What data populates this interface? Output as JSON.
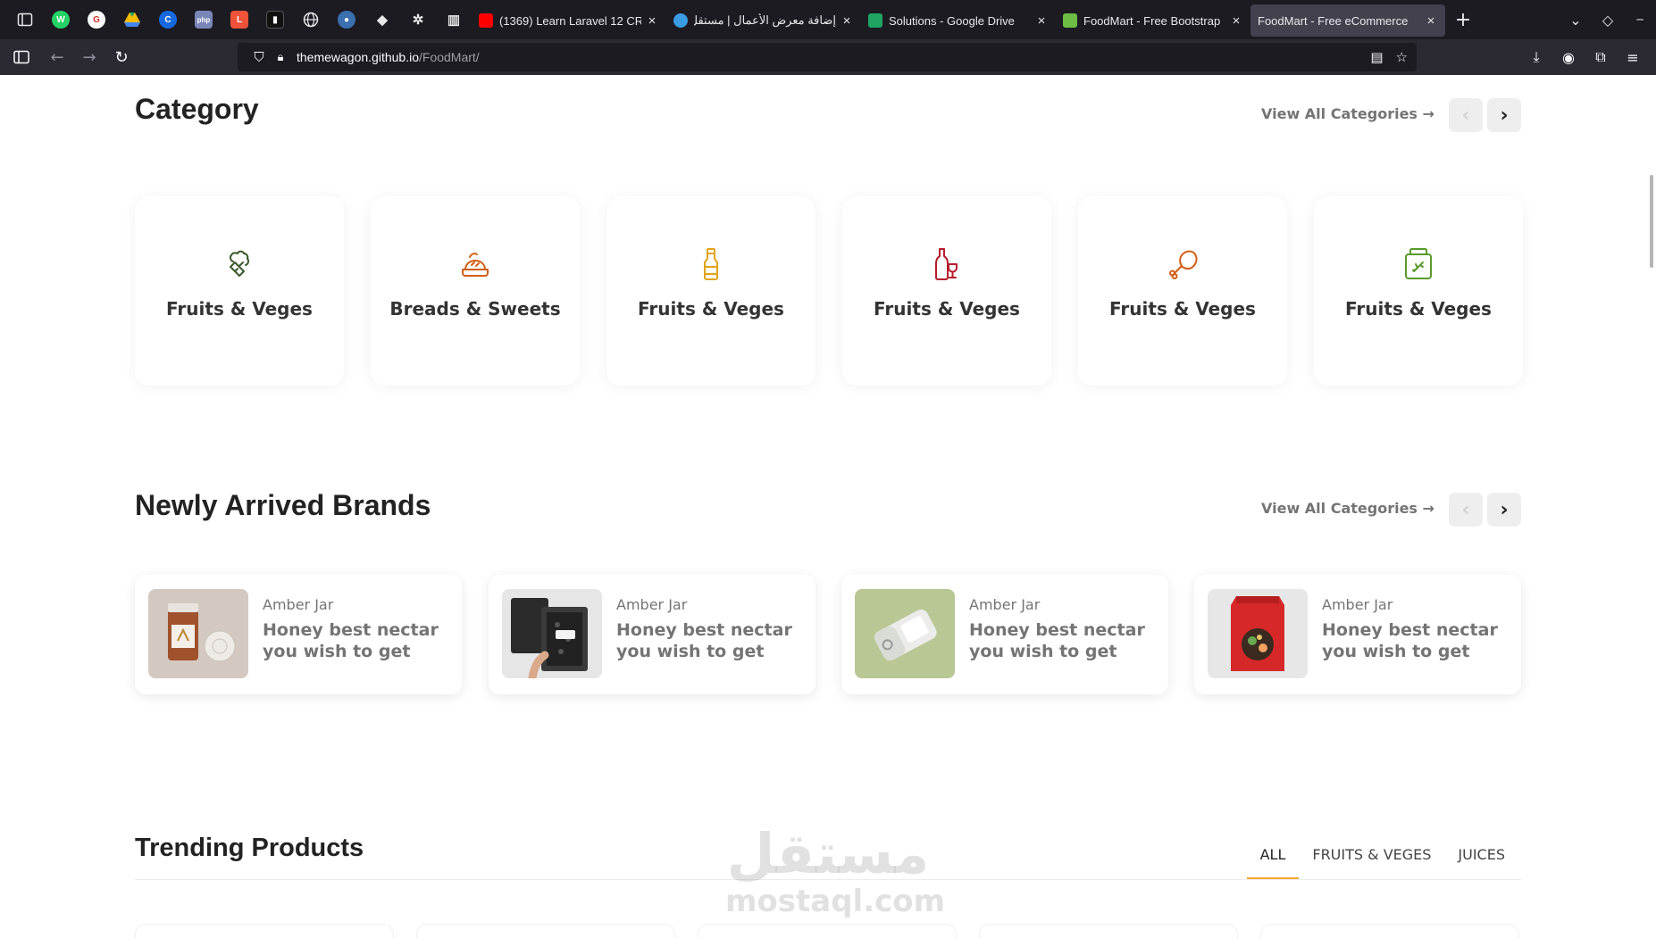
{
  "browser": {
    "pinned_icons": [
      "whatsapp-icon",
      "google-drive-icon",
      "google-drive-icon",
      "c-icon",
      "php-icon",
      "laravel-icon",
      "dark-app-icon",
      "globe-icon",
      "earth-icon",
      "gem-icon",
      "openai-icon",
      "book-icon"
    ],
    "tabs": [
      {
        "title": "(1369) Learn Laravel 12 CR",
        "favicon": "youtube-icon",
        "color": "#ff0000"
      },
      {
        "title": "إضافة معرض الأعمال | مستقل",
        "favicon": "mostaql-icon",
        "color": "#3a9de4"
      },
      {
        "title": "Solutions - Google Drive",
        "favicon": "google-drive-icon",
        "color": "#1fa463"
      },
      {
        "title": "FoodMart - Free Bootstrap",
        "favicon": "foodmart-icon",
        "color": "#6dbd45"
      },
      {
        "title": "FoodMart - Free eCommerce",
        "favicon": "foodmart-icon",
        "color": "#6dbd45",
        "active": true
      }
    ],
    "url_host": "themewagon.github.io",
    "url_path": "/FoodMart/"
  },
  "category": {
    "title": "Category",
    "view_all": "View All Categories →",
    "items": [
      {
        "label": "Fruits & Veges",
        "icon": "broccoli-icon",
        "color": "#3b5a2a"
      },
      {
        "label": "Breads & Sweets",
        "icon": "bread-icon",
        "color": "#d35e14"
      },
      {
        "label": "Fruits & Veges",
        "icon": "bottle-icon",
        "color": "#e0a418"
      },
      {
        "label": "Fruits & Veges",
        "icon": "wine-icon",
        "color": "#b71c2c"
      },
      {
        "label": "Fruits & Veges",
        "icon": "drumstick-icon",
        "color": "#d35e14"
      },
      {
        "label": "Fruits & Veges",
        "icon": "jar-icon",
        "color": "#5a9a2a"
      }
    ]
  },
  "brands": {
    "title": "Newly Arrived Brands",
    "view_all": "View All Categories →",
    "items": [
      {
        "subtitle": "Amber Jar",
        "title": "Honey best nectar you wish to get",
        "image": "jar-product-image"
      },
      {
        "subtitle": "Amber Jar",
        "title": "Honey best nectar you wish to get",
        "image": "tea-bag-product-image"
      },
      {
        "subtitle": "Amber Jar",
        "title": "Honey best nectar you wish to get",
        "image": "tin-can-product-image"
      },
      {
        "subtitle": "Amber Jar",
        "title": "Honey best nectar you wish to get",
        "image": "food-pouch-product-image"
      }
    ]
  },
  "trending": {
    "title": "Trending Products",
    "tabs": [
      {
        "label": "ALL",
        "active": true
      },
      {
        "label": "FRUITS & VEGES",
        "active": false
      },
      {
        "label": "JUICES",
        "active": false
      }
    ]
  },
  "watermark": {
    "arabic": "مستقل",
    "latin": "mostaql.com"
  },
  "colors": {
    "accent": "#f7a932",
    "text_dark": "#222222",
    "text_muted": "#747474"
  }
}
